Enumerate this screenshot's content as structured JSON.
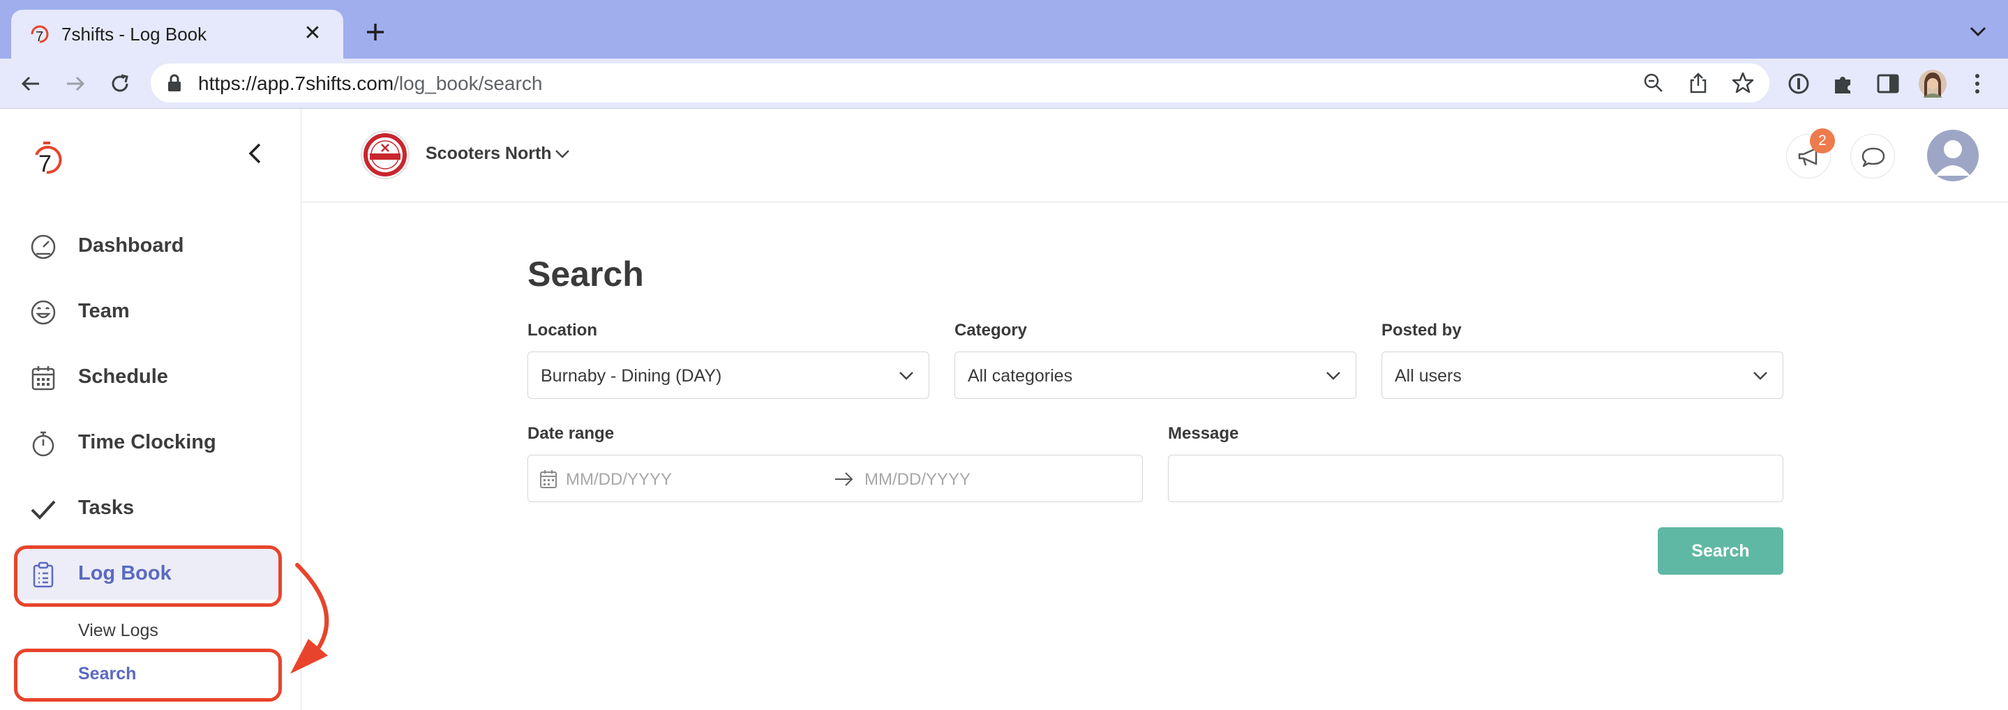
{
  "browser": {
    "tab_title": "7shifts - Log Book",
    "tab_close": "✕",
    "url_host": "https://app.7shifts.com",
    "url_path": "/log_book/search"
  },
  "sidebar": {
    "items": [
      {
        "label": "Dashboard",
        "icon": "dashboard-gauge-icon"
      },
      {
        "label": "Team",
        "icon": "team-smiley-icon"
      },
      {
        "label": "Schedule",
        "icon": "calendar-icon"
      },
      {
        "label": "Time Clocking",
        "icon": "stopwatch-icon"
      },
      {
        "label": "Tasks",
        "icon": "checkmark-icon"
      },
      {
        "label": "Log Book",
        "icon": "clipboard-icon",
        "active": true
      }
    ],
    "subitems": [
      {
        "label": "View Logs"
      },
      {
        "label": "Search",
        "active": true
      }
    ]
  },
  "header": {
    "location_name": "Scooters North",
    "notification_count": "2"
  },
  "form": {
    "title": "Search",
    "location_label": "Location",
    "location_value": "Burnaby - Dining (DAY)",
    "category_label": "Category",
    "category_value": "All categories",
    "posted_by_label": "Posted by",
    "posted_by_value": "All users",
    "date_range_label": "Date range",
    "date_start_placeholder": "MM/DD/YYYY",
    "date_end_placeholder": "MM/DD/YYYY",
    "message_label": "Message",
    "message_value": "",
    "search_button": "Search"
  },
  "colors": {
    "brand_accent": "#5b6ac0",
    "button_teal": "#5fb8a3",
    "annotation_red": "#e8442b",
    "badge_orange": "#ee7b4d"
  }
}
